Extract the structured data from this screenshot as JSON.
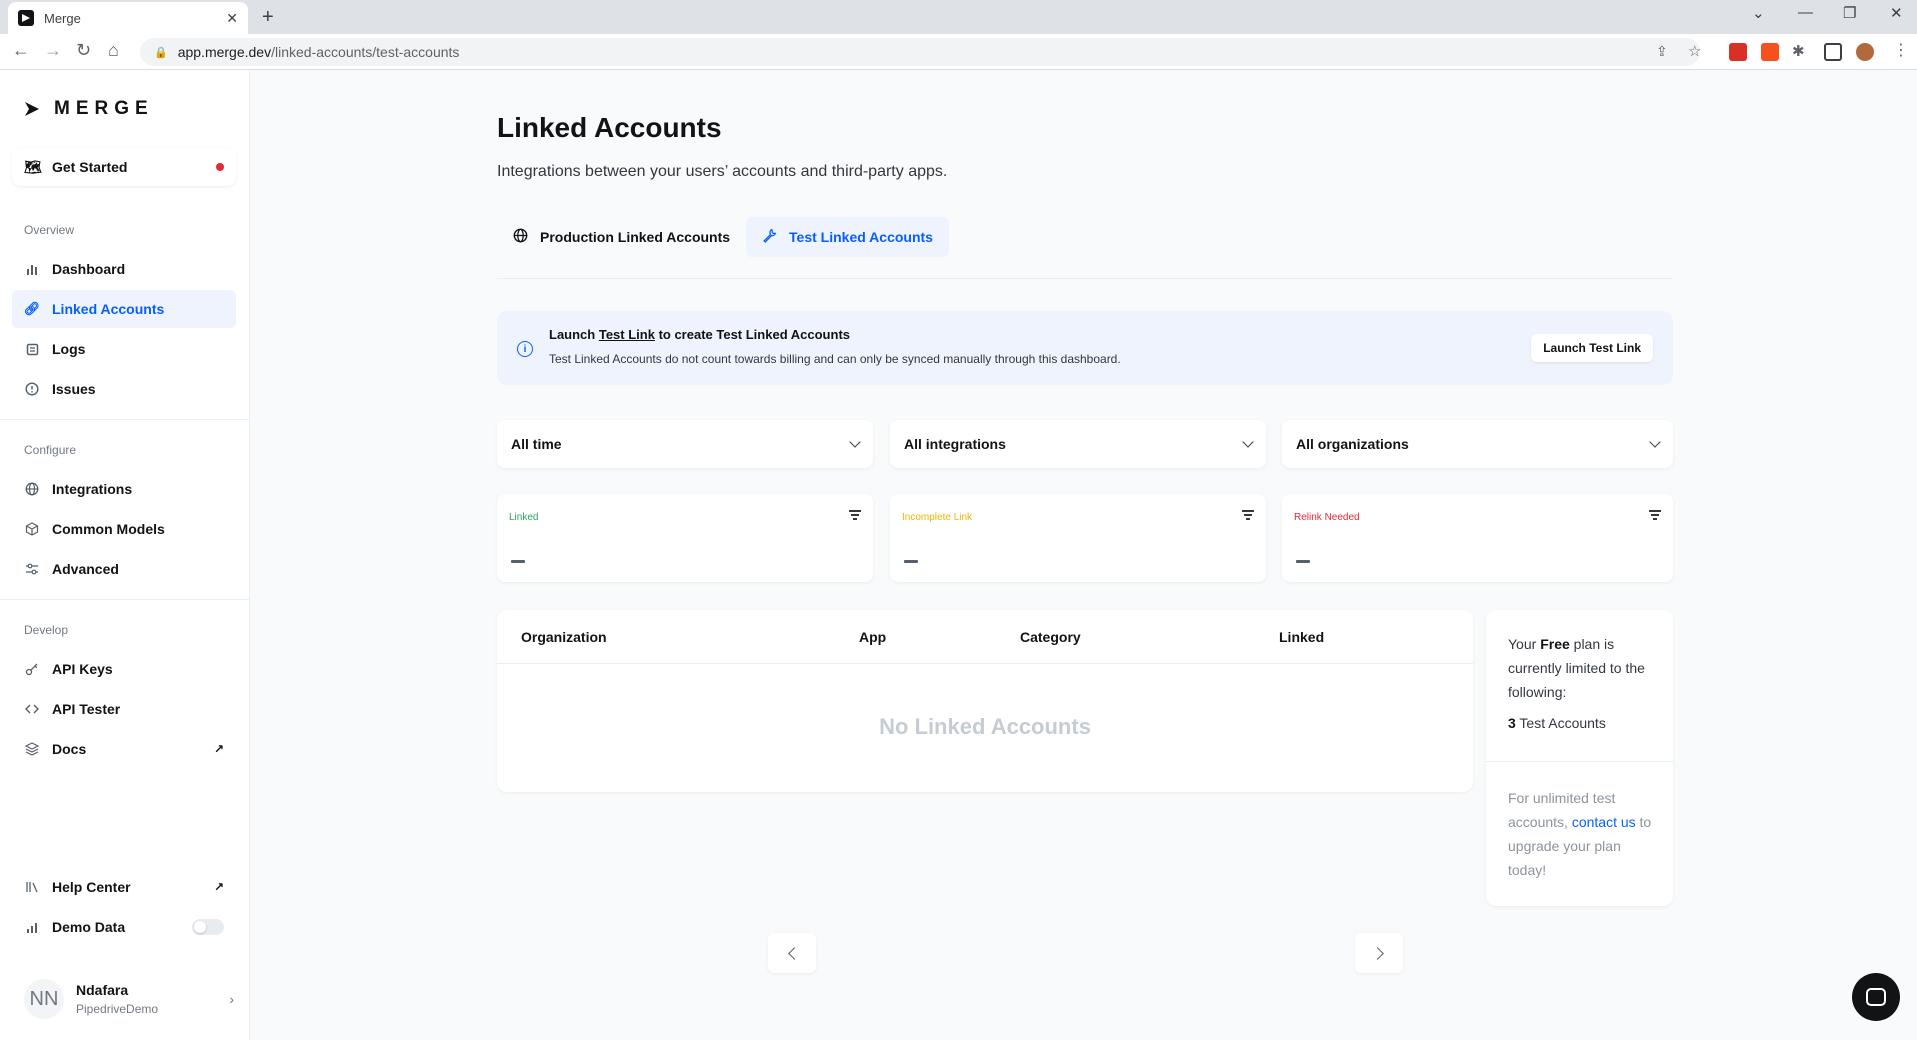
{
  "browser": {
    "tab_title": "Merge",
    "url_host": "app.merge.dev",
    "url_path": "/linked-accounts/test-accounts"
  },
  "sidebar": {
    "brand": "MERGE",
    "get_started": "Get Started",
    "overview_label": "Overview",
    "overview_items": [
      {
        "label": "Dashboard",
        "icon": "bar-chart-icon"
      },
      {
        "label": "Linked Accounts",
        "icon": "link-icon"
      },
      {
        "label": "Logs",
        "icon": "logs-icon"
      },
      {
        "label": "Issues",
        "icon": "alert-circle-icon"
      }
    ],
    "configure_label": "Configure",
    "configure_items": [
      {
        "label": "Integrations",
        "icon": "globe-icon"
      },
      {
        "label": "Common Models",
        "icon": "cube-icon"
      },
      {
        "label": "Advanced",
        "icon": "sliders-icon"
      }
    ],
    "develop_label": "Develop",
    "develop_items": [
      {
        "label": "API Keys",
        "icon": "key-icon"
      },
      {
        "label": "API Tester",
        "icon": "code-icon"
      },
      {
        "label": "Docs",
        "icon": "layers-icon"
      }
    ],
    "help_center": "Help Center",
    "demo_data": "Demo Data",
    "demo_data_enabled": false,
    "user": {
      "initials": "NN",
      "name": "Ndafara",
      "org": "PipedriveDemo"
    }
  },
  "main": {
    "title": "Linked Accounts",
    "subtitle": "Integrations between your users’ accounts and third-party apps.",
    "tabs": [
      {
        "label": "Production Linked Accounts",
        "active": false
      },
      {
        "label": "Test Linked Accounts",
        "active": true
      }
    ],
    "banner": {
      "title_pre": "Launch ",
      "title_link": "Test Link",
      "title_post": " to create Test Linked Accounts",
      "description": "Test Linked Accounts do not count towards billing and can only be synced manually through this dashboard.",
      "button": "Launch Test Link"
    },
    "filters": [
      "All time",
      "All integrations",
      "All organizations"
    ],
    "stats": [
      {
        "label": "Linked",
        "color": "#26a65b"
      },
      {
        "label": "Incomplete Link",
        "color": "#f0b400"
      },
      {
        "label": "Relink Needed",
        "color": "#e62837"
      }
    ],
    "table": {
      "columns": [
        "Organization",
        "App",
        "Category",
        "Linked"
      ],
      "empty_text": "No Linked Accounts"
    },
    "plan": {
      "line_pre": "Your ",
      "plan_name": "Free",
      "line_post": " plan is currently limited to the following:",
      "count": "3",
      "count_label": " Test Accounts",
      "upgrade_pre": "For unlimited test accounts, ",
      "upgrade_link": "contact us",
      "upgrade_post": " to upgrade your plan today!"
    }
  },
  "colors": {
    "accent": "#075ff7",
    "alert": "#e62837"
  }
}
